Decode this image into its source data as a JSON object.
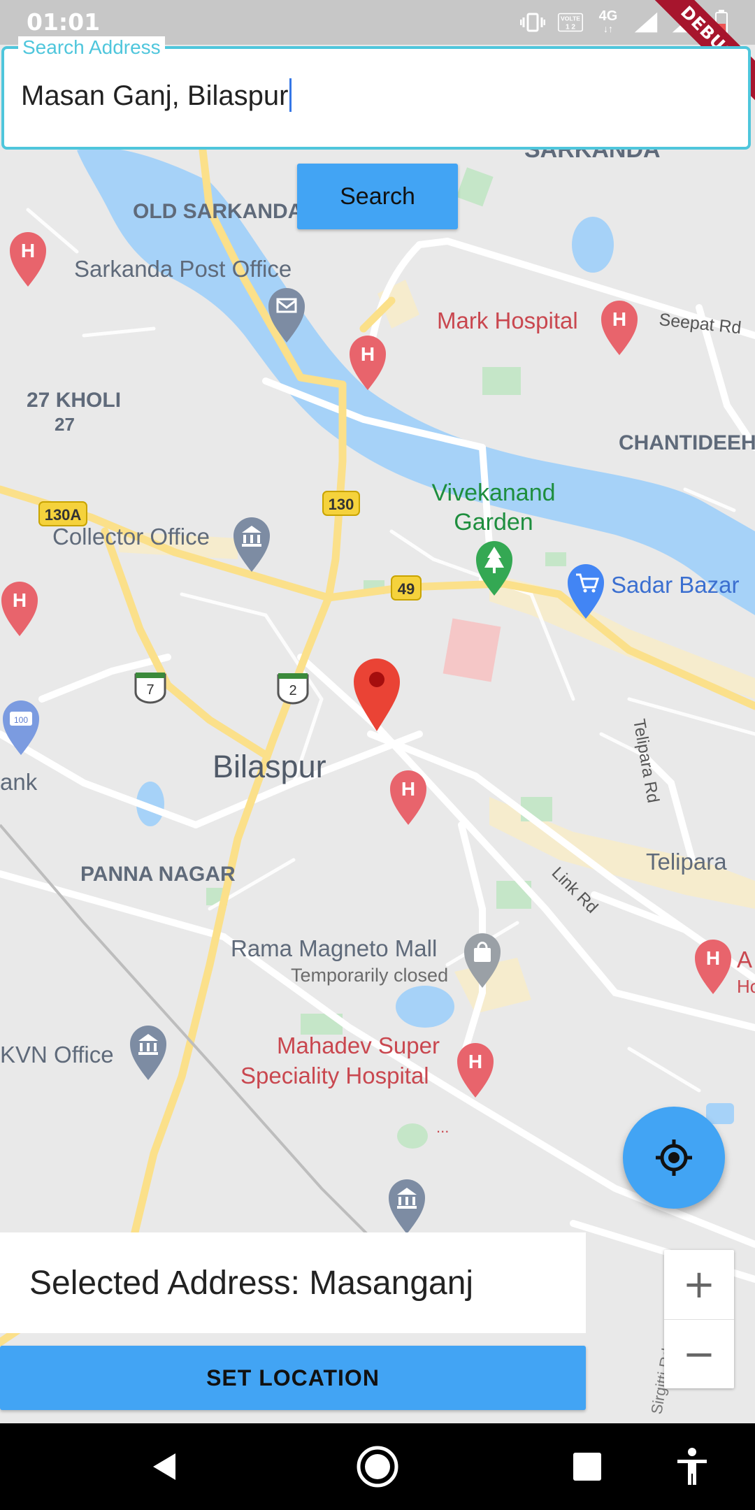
{
  "status_bar": {
    "time": "01:01",
    "network_label": "4G",
    "debug_label": "DEBUG"
  },
  "search": {
    "label": "Search Address",
    "value": "Masan Ganj, Bilaspur",
    "button_label": "Search"
  },
  "map": {
    "labels": {
      "sarkanda": "SARKANDA",
      "old_sarkanda": "OLD SARKANDA",
      "sarkanda_post_office": "Sarkanda Post Office",
      "mark_hospital": "Mark Hospital",
      "seepat_rd": "Seepat Rd",
      "kholi": "27 KHOLI",
      "kholi_num": "27",
      "chantideeh": "CHANTIDEEH",
      "vivekanand_garden_1": "Vivekanand",
      "vivekanand_garden_2": "Garden",
      "collector_office": "Collector Office",
      "sadar_bazar": "Sadar Bazar",
      "telipara_rd": "Telipara Rd",
      "bilaspur": "Bilaspur",
      "bank": "ank",
      "panna_nagar": "PANNA NAGAR",
      "telipara": "Telipara",
      "link_rd": "Link Rd",
      "rama_magneto_mall": "Rama Magneto Mall",
      "temporarily_closed": "Temporarily closed",
      "kvn_office": "KVN Office",
      "mahadev_1": "Mahadev Super",
      "mahadev_2": "Speciality Hospital",
      "a_hospital_1": "A",
      "a_hospital_2": "Ho",
      "sirgitti_rd": "Sirgitti Rd",
      "dots": "...",
      "shield_130a": "130A",
      "shield_130": "130",
      "shield_49": "49",
      "shield_7": "7",
      "shield_2": "2",
      "poi_100": "100"
    },
    "colors": {
      "land": "#e9e9e9",
      "water": "#a6d2f8",
      "highway": "#fbe08a",
      "road": "#ffffff",
      "park": "#c5e6c8",
      "urban": "#f6eccd"
    }
  },
  "selected_address": {
    "text": "Selected Address: Masanganj"
  },
  "set_location": {
    "label": "SET LOCATION"
  },
  "zoom": {
    "in": "+",
    "out": "−"
  },
  "colors": {
    "accent": "#42a4f4",
    "focus_border": "#4fc6dc",
    "marker": "#ea4335",
    "hospital": "#e8646c"
  }
}
